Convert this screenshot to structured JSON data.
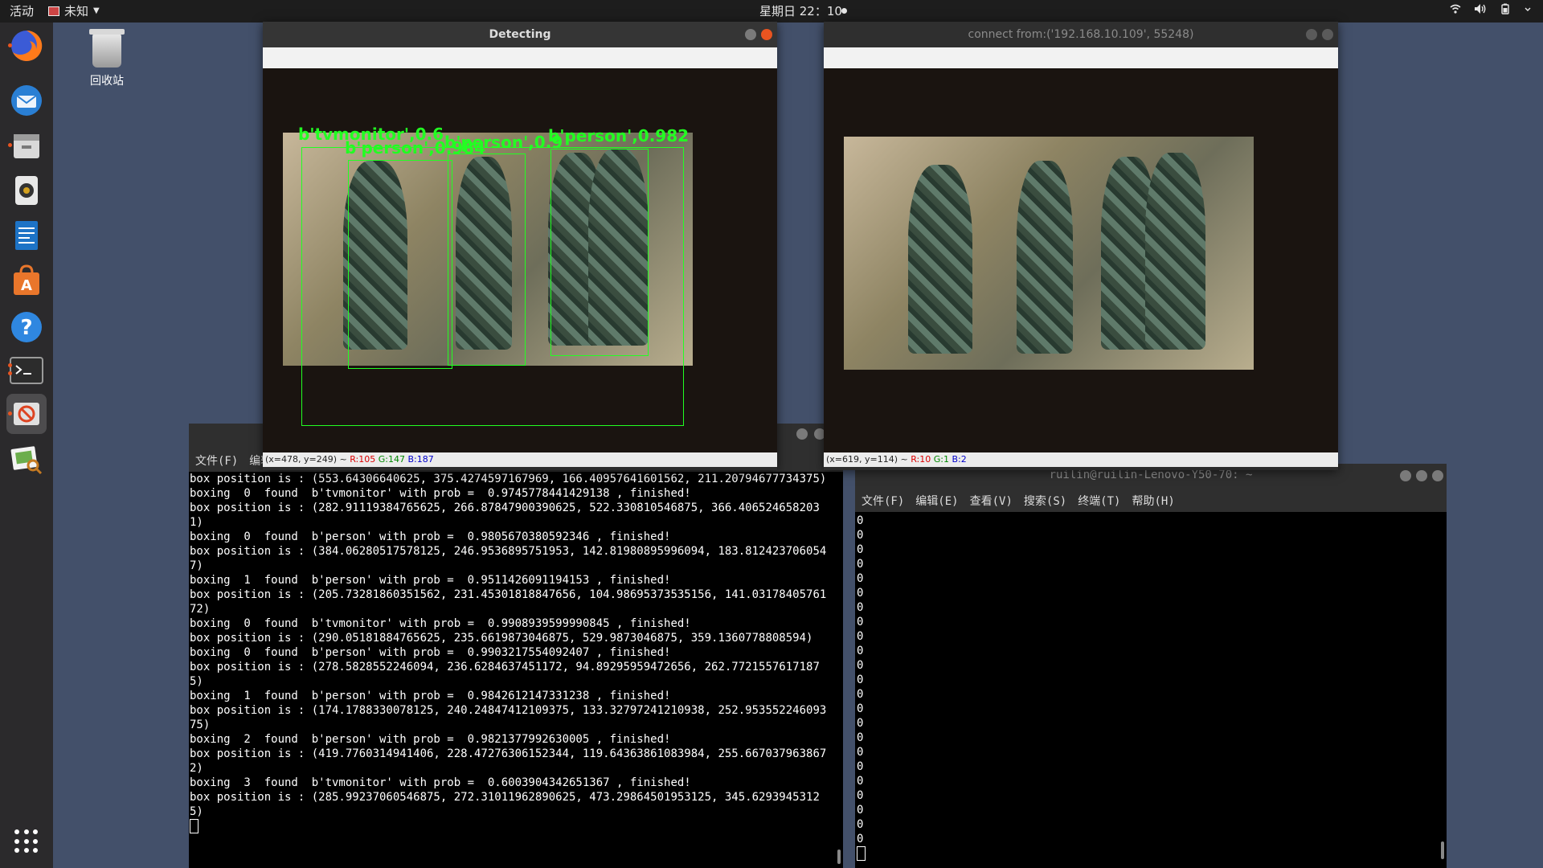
{
  "topbar": {
    "activities": "活动",
    "app_menu": "未知",
    "clock": "星期日 22：10",
    "tray_icons": [
      "wifi-icon",
      "volume-icon",
      "battery-icon",
      "power-menu-icon"
    ]
  },
  "dock": {
    "items": [
      "firefox-icon",
      "thunderbird-icon",
      "files-icon",
      "rhythmbox-icon",
      "writer-icon",
      "software-center-icon",
      "help-icon",
      "terminal-icon",
      "blocked-app-icon",
      "image-viewer-icon"
    ],
    "show_apps_icon": "app-grid-icon"
  },
  "desktop": {
    "trash_label": "回收站"
  },
  "detect_window": {
    "title": "Detecting",
    "status": {
      "coords": "(x=478, y=249) ~ ",
      "r": "R:105",
      "g": "G:147",
      "b": "B:187"
    },
    "labels": [
      "b'tvmonitor',0.6",
      "b'person',0.984",
      "b'person',0.9",
      "b'person',0.982"
    ]
  },
  "connect_window": {
    "title": "connect from:('192.168.10.109', 55248)",
    "status": {
      "coords": "(x=619, y=114) ~ ",
      "r": "R:10",
      "g": "G:1",
      "b": "B:2"
    }
  },
  "left_terminal": {
    "menu": [
      "文件(F)",
      "编辑"
    ],
    "lines": [
      "box position is : (553.64306640625, 375.4274597167969, 166.40957641601562, 211.20794677734375)",
      "boxing  0  found  b'tvmonitor' with prob =  0.9745778441429138 , finished!",
      "box position is : (282.91119384765625, 266.87847900390625, 522.330810546875, 366.4065246582031)",
      "boxing  0  found  b'person' with prob =  0.9805670380592346 , finished!",
      "box position is : (384.06280517578125, 246.9536895751953, 142.81980895996094, 183.8124237060547)",
      "boxing  1  found  b'person' with prob =  0.9511426091194153 , finished!",
      "box position is : (205.73281860351562, 231.45301818847656, 104.98695373535156, 141.0317840576172)",
      "boxing  0  found  b'tvmonitor' with prob =  0.9908939599990845 , finished!",
      "box position is : (290.05181884765625, 235.6619873046875, 529.9873046875, 359.1360778808594)",
      "boxing  0  found  b'person' with prob =  0.9903217554092407 , finished!",
      "box position is : (278.5828552246094, 236.6284637451172, 94.89295959472656, 262.77215576171875)",
      "boxing  1  found  b'person' with prob =  0.9842612147331238 , finished!",
      "box position is : (174.1788330078125, 240.24847412109375, 133.32797241210938, 252.95355224609375)",
      "boxing  2  found  b'person' with prob =  0.9821377992630005 , finished!",
      "box position is : (419.7760314941406, 228.47276306152344, 119.64363861083984, 255.6670379638672)",
      "boxing  3  found  b'tvmonitor' with prob =  0.6003904342651367 , finished!",
      "box position is : (285.99237060546875, 272.31011962890625, 473.29864501953125, 345.62939453125)"
    ]
  },
  "right_terminal": {
    "title": "ruilin@ruilin-Lenovo-Y50-70: ~",
    "menu": [
      "文件(F)",
      "编辑(E)",
      "查看(V)",
      "搜索(S)",
      "终端(T)",
      "帮助(H)"
    ],
    "zeros": [
      "0",
      "0",
      "0",
      "0",
      "0",
      "0",
      "0",
      "0",
      "0",
      "0",
      "0",
      "0",
      "0",
      "0",
      "0",
      "0",
      "0",
      "0",
      "0",
      "0",
      "0",
      "0",
      "0"
    ]
  }
}
